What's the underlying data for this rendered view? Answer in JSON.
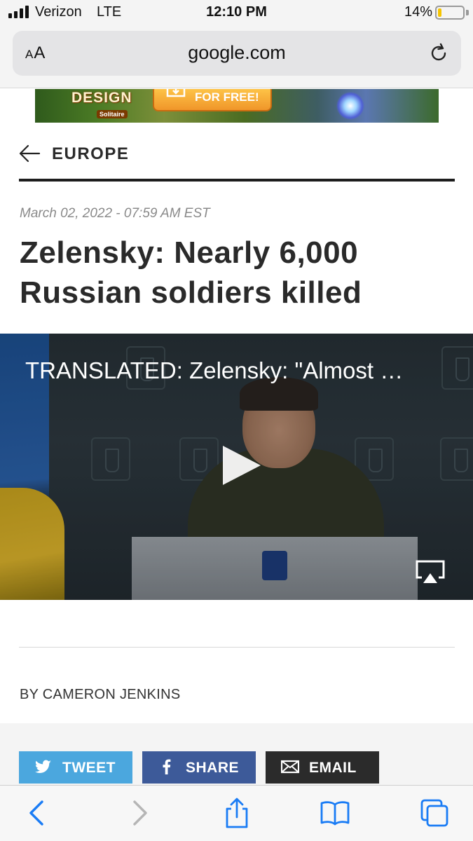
{
  "status_bar": {
    "carrier": "Verizon",
    "network": "LTE",
    "time": "12:10 PM",
    "battery": "14%",
    "battery_level": 0.14
  },
  "address_bar": {
    "reader_label": "AA",
    "url": "google.com"
  },
  "ad": {
    "brand": "DESIGN",
    "sub": "Solitaire",
    "cta": "FOR FREE!"
  },
  "section": {
    "title": "EUROPE"
  },
  "article": {
    "timestamp": "March 02, 2022 - 07:59 AM EST",
    "headline": "Zelensky: Nearly 6,000 Russian soldiers killed",
    "byline": "BY CAMERON JENKINS"
  },
  "video": {
    "title": "TRANSLATED: Zelensky: \"Almost …"
  },
  "share": {
    "tweet": "TWEET",
    "share": "SHARE",
    "email": "EMAIL"
  },
  "colors": {
    "tweet": "#4ba7de",
    "facebook": "#3d5a99",
    "email": "#2b2b2b",
    "safari_blue": "#1a7cf5"
  },
  "toolbar_icons": [
    "back-icon",
    "forward-icon",
    "share-icon",
    "bookmarks-icon",
    "tabs-icon"
  ]
}
